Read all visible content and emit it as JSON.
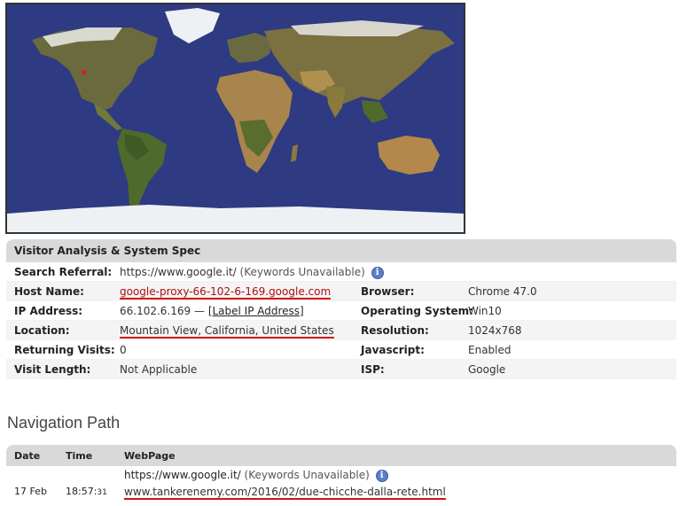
{
  "map": {
    "marker_color": "#e8161a"
  },
  "visitor": {
    "title": "Visitor Analysis & System Spec",
    "search_referral_label": "Search Referral:",
    "search_referral_value": "https://www.google.it/",
    "search_referral_note": "(Keywords Unavailable)",
    "host_name_label": "Host Name:",
    "host_name_value": "google-proxy-66-102-6-169.google.com",
    "ip_label": "IP Address:",
    "ip_value": "66.102.6.169 —",
    "ip_link": "[Label IP Address]",
    "location_label": "Location:",
    "location_value": "Mountain View, California, United States",
    "returning_label": "Returning Visits:",
    "returning_value": "0",
    "visit_length_label": "Visit Length:",
    "visit_length_value": "Not Applicable",
    "browser_label": "Browser:",
    "browser_value": "Chrome 47.0",
    "os_label": "Operating System:",
    "os_value": "Win10",
    "resolution_label": "Resolution:",
    "resolution_value": "1024x768",
    "javascript_label": "Javascript:",
    "javascript_value": "Enabled",
    "isp_label": "ISP:",
    "isp_value": "Google",
    "info_glyph": "i"
  },
  "navigation": {
    "title": "Navigation Path",
    "headers": {
      "date": "Date",
      "time": "Time",
      "webpage": "WebPage"
    },
    "row": {
      "date": "17 Feb",
      "time_main": "18:57:",
      "time_seconds": "31",
      "referral": "https://www.google.it/",
      "referral_note": "(Keywords Unavailable)",
      "page": "www.tankerenemy.com/2016/02/due-chicche-dalla-rete.html"
    }
  },
  "colors": {
    "highlight_underline": "#d21212",
    "header_bg": "#d9d9d9",
    "ocean": "#2e3a82"
  }
}
